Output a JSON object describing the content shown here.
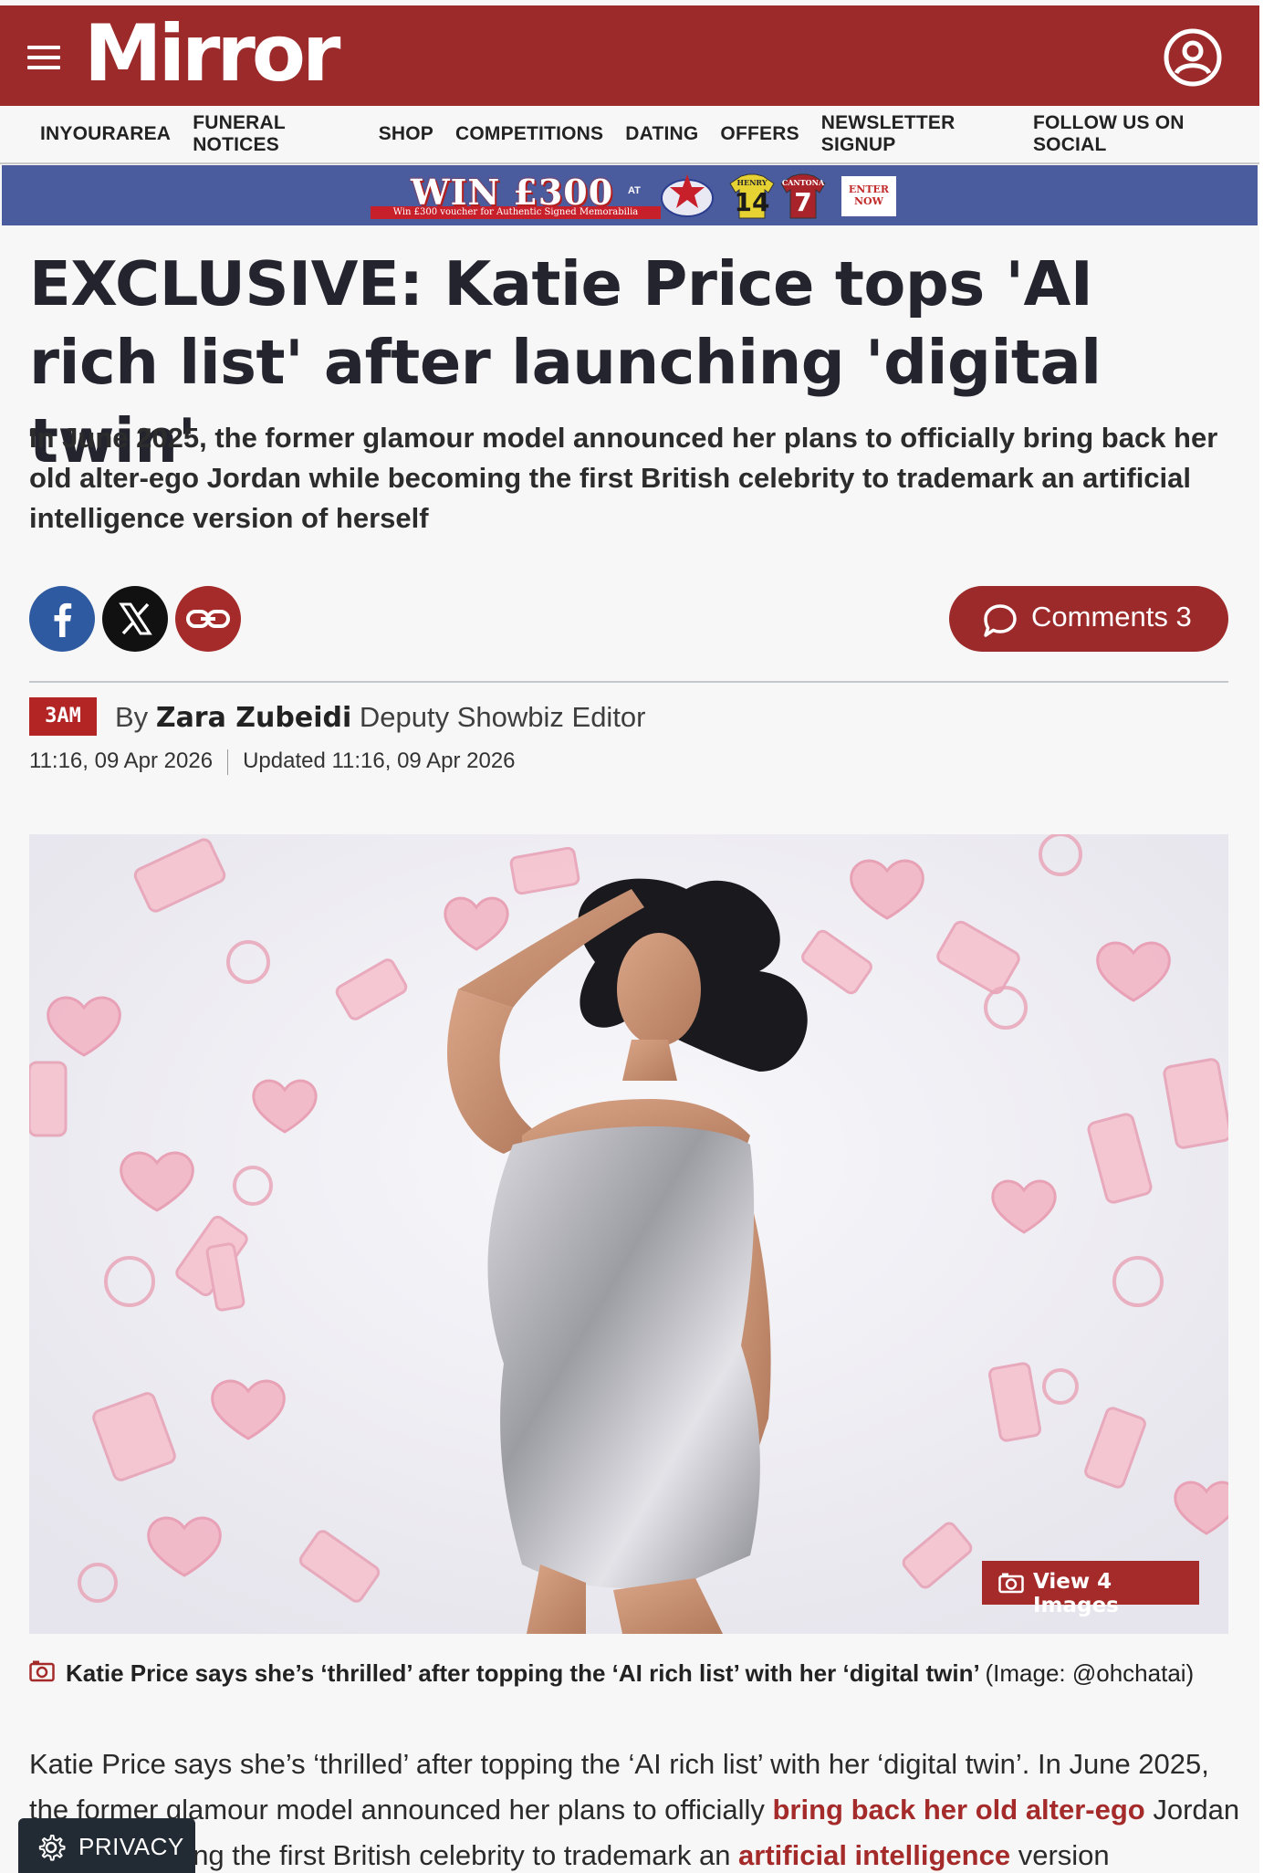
{
  "header": {
    "logo_text": "Mirror",
    "brand_color": "#9c2a2a",
    "menu_icon": "hamburger-icon",
    "account_icon": "user-account-icon"
  },
  "nav": {
    "items": [
      {
        "label": "INYOURAREA"
      },
      {
        "label": "FUNERAL NOTICES"
      },
      {
        "label": "SHOP"
      },
      {
        "label": "COMPETITIONS"
      },
      {
        "label": "DATING"
      },
      {
        "label": "OFFERS"
      },
      {
        "label": "NEWSLETTER SIGNUP"
      },
      {
        "label": "FOLLOW US ON SOCIAL"
      }
    ]
  },
  "banner": {
    "headline": "WIN £300",
    "at": "AT",
    "subline": "Win £300 voucher for Authentic Signed Memorabilia",
    "shirt1_name": "HENRY",
    "shirt1_number": "14",
    "shirt2_name": "CANTONA",
    "shirt2_number": "7",
    "cta": "ENTER NOW"
  },
  "article": {
    "headline": "EXCLUSIVE: Katie Price tops 'AI rich list' after launching 'digital twin'",
    "standfirst": "In June 2025, the former glamour model announced her plans to officially bring back her old alter-ego Jordan while becoming the first British celebrity to trademark an artificial intelligence version of herself",
    "share": {
      "facebook_icon": "facebook-icon",
      "x_icon": "x-icon",
      "link_icon": "link-icon"
    },
    "comments_label": "Comments 3",
    "time_badge": "3AM",
    "byline_prefix": "By",
    "author": "Zara Zubeidi",
    "author_role": "Deputy Showbiz Editor",
    "published": "11:16, 09 Apr 2026",
    "updated": "Updated 11:16, 09 Apr 2026",
    "view_images_label": "View 4 Images",
    "caption": "Katie Price says she’s ‘thrilled’ after topping the ‘AI rich list’ with her ‘digital twin’",
    "caption_credit": "(Image: @ohchatai)",
    "body": {
      "p1_start": "Katie Price says she’s ‘thrilled’ after topping the ‘AI rich list’ with her ‘digital twin’. In June 2025, the former glamour model announced her plans to officially ",
      "p1_link1": "bring back her old alter-ego",
      "p1_mid": " Jordan while becoming the first British celebrity to trademark an ",
      "p1_link2": "artificial intelligence",
      "p1_end": " version"
    }
  },
  "privacy": {
    "label": "PRIVACY",
    "icon": "gear-icon"
  }
}
